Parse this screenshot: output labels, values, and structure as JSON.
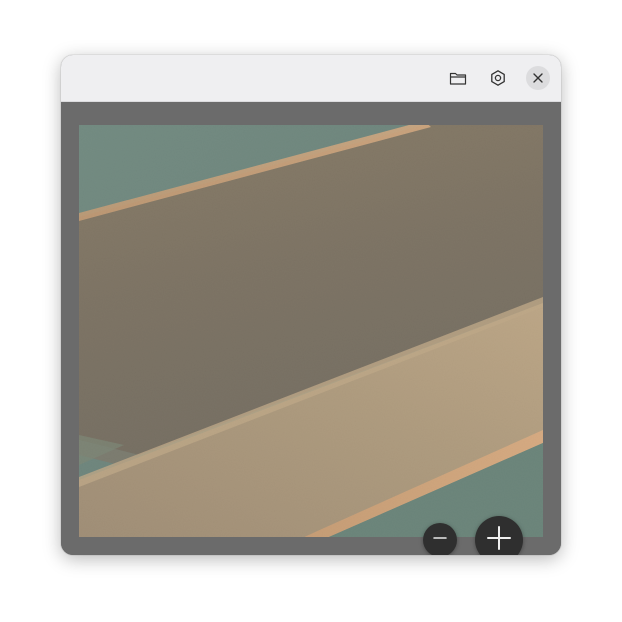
{
  "titlebar": {
    "actions": [
      {
        "name": "open-folder",
        "icon": "folder-icon"
      },
      {
        "name": "settings",
        "icon": "gear-icon"
      },
      {
        "name": "close",
        "icon": "close-icon"
      }
    ]
  },
  "viewer": {
    "image": {
      "description_colors": {
        "background_teal": "#22463a",
        "wood_dark": "#3f2f17",
        "wood_light": "#8a6a3c",
        "wood_edge": "#b0763a"
      }
    },
    "zoom_controls": [
      {
        "name": "zoom-out",
        "icon": "minus-icon"
      },
      {
        "name": "zoom-in",
        "icon": "plus-icon"
      }
    ]
  },
  "colors": {
    "titlebar_bg": "#efeff1",
    "canvas_bg": "#6b6b6b",
    "zoom_button_bg": "#2f2f2f",
    "close_button_bg": "#dcdcde"
  }
}
